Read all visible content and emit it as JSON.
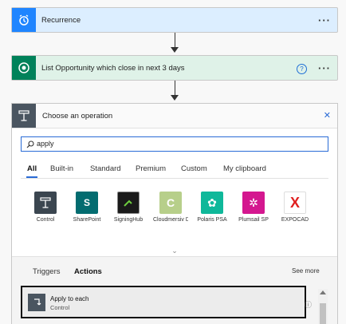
{
  "steps": [
    {
      "title": "Recurrence",
      "menu": "···",
      "icon": "alarm-clock-icon",
      "color": "#1f85ff"
    },
    {
      "title": "List Opportunity which close in next 3 days",
      "menu": "···",
      "help": "?",
      "icon": "dynamics-icon",
      "color": "#00825a"
    }
  ],
  "panel": {
    "title": "Choose an operation",
    "close": "✕",
    "search_value": "apply",
    "tabs": [
      "All",
      "Built-in",
      "Standard",
      "Premium",
      "Custom",
      "My clipboard"
    ],
    "active_tab": "All",
    "connectors": [
      {
        "label": "Control",
        "color": "#3b4650"
      },
      {
        "label": "SharePoint",
        "color": "#036c70"
      },
      {
        "label": "SigningHub",
        "color": "#1a1a1a"
      },
      {
        "label": "Cloudmersiv Documen…",
        "color": "#b7cf8a"
      },
      {
        "label": "Polaris PSA",
        "color": "#0fb89a"
      },
      {
        "label": "Plumsail SP",
        "color": "#d4178f"
      },
      {
        "label": "EXPOCAD",
        "color": "#ffffff"
      }
    ],
    "expand": "⌄",
    "subtabs": [
      "Triggers",
      "Actions"
    ],
    "see_more": "See more",
    "results": [
      {
        "title": "Apply to each",
        "subtitle": "Control",
        "info": "ⓘ"
      }
    ]
  }
}
